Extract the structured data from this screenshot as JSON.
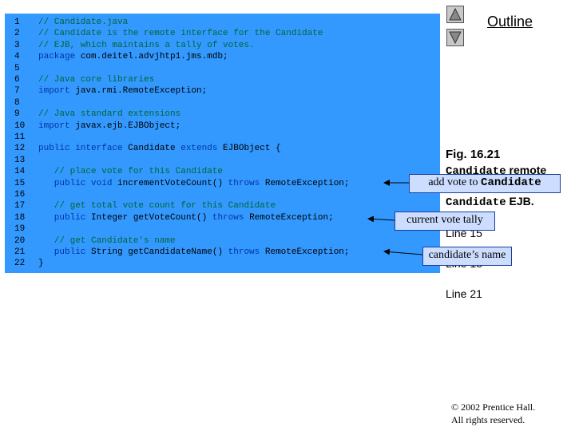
{
  "outline": {
    "title": "Outline"
  },
  "nav": {
    "up_icon": "triangle-up-icon",
    "down_icon": "triangle-down-icon"
  },
  "code_lines": [
    {
      "n": "1",
      "segs": [
        {
          "t": "// Candidate.java",
          "c": "cm"
        }
      ]
    },
    {
      "n": "2",
      "segs": [
        {
          "t": "// Candidate is the remote interface for the Candidate",
          "c": "cm"
        }
      ]
    },
    {
      "n": "3",
      "segs": [
        {
          "t": "// EJB, which maintains a tally of votes.",
          "c": "cm"
        }
      ]
    },
    {
      "n": "4",
      "segs": [
        {
          "t": "package ",
          "c": "kw"
        },
        {
          "t": "com.deitel.advjhtp1.jms.mdb;",
          "c": "tx"
        }
      ]
    },
    {
      "n": "5",
      "segs": []
    },
    {
      "n": "6",
      "segs": [
        {
          "t": "// Java core libraries",
          "c": "cm"
        }
      ]
    },
    {
      "n": "7",
      "segs": [
        {
          "t": "import ",
          "c": "kw"
        },
        {
          "t": "java.rmi.RemoteException;",
          "c": "tx"
        }
      ]
    },
    {
      "n": "8",
      "segs": []
    },
    {
      "n": "9",
      "segs": [
        {
          "t": "// Java standard extensions",
          "c": "cm"
        }
      ]
    },
    {
      "n": "10",
      "segs": [
        {
          "t": "import ",
          "c": "kw"
        },
        {
          "t": "javax.ejb.EJBObject;",
          "c": "tx"
        }
      ]
    },
    {
      "n": "11",
      "segs": []
    },
    {
      "n": "12",
      "segs": [
        {
          "t": "public interface ",
          "c": "kw"
        },
        {
          "t": "Candidate ",
          "c": "tx"
        },
        {
          "t": "extends ",
          "c": "kw"
        },
        {
          "t": "EJBObject {",
          "c": "tx"
        }
      ]
    },
    {
      "n": "13",
      "segs": []
    },
    {
      "n": "14",
      "segs": [
        {
          "t": "   // place vote for this Candidate",
          "c": "cm"
        }
      ]
    },
    {
      "n": "15",
      "segs": [
        {
          "t": "   public void ",
          "c": "kw"
        },
        {
          "t": "incrementVoteCount() ",
          "c": "tx"
        },
        {
          "t": "throws ",
          "c": "kw"
        },
        {
          "t": "RemoteException;",
          "c": "tx"
        }
      ]
    },
    {
      "n": "16",
      "segs": []
    },
    {
      "n": "17",
      "segs": [
        {
          "t": "   // get total vote count for this Candidate",
          "c": "cm"
        }
      ]
    },
    {
      "n": "18",
      "segs": [
        {
          "t": "   public ",
          "c": "kw"
        },
        {
          "t": "Integer getVoteCount() ",
          "c": "tx"
        },
        {
          "t": "throws ",
          "c": "kw"
        },
        {
          "t": "RemoteException;",
          "c": "tx"
        }
      ]
    },
    {
      "n": "19",
      "segs": []
    },
    {
      "n": "20",
      "segs": [
        {
          "t": "   // get Candidate's name",
          "c": "cm"
        }
      ]
    },
    {
      "n": "21",
      "segs": [
        {
          "t": "   public ",
          "c": "kw"
        },
        {
          "t": "String getCandidateName() ",
          "c": "tx"
        },
        {
          "t": "throws ",
          "c": "kw"
        },
        {
          "t": "RemoteException;",
          "c": "tx"
        }
      ]
    },
    {
      "n": "22",
      "segs": [
        {
          "t": "}",
          "c": "tx"
        }
      ]
    }
  ],
  "side_notes": {
    "fig_label": "Fig. 16.21",
    "fig_code1": "Candidate",
    "fig_text1": " remote",
    "fig_code2": "Candidate",
    "fig_text2": " EJB.",
    "line15": "Line 15",
    "line18": "Line 18",
    "line21": "Line 21"
  },
  "callouts": {
    "add_vote_text": "add vote to ",
    "add_vote_code": "Candidate",
    "vote_tally": "current vote tally",
    "candidate_name": "candidate’s name"
  },
  "copyright": {
    "line1": "© 2002 Prentice Hall.",
    "line2": "All rights reserved."
  }
}
